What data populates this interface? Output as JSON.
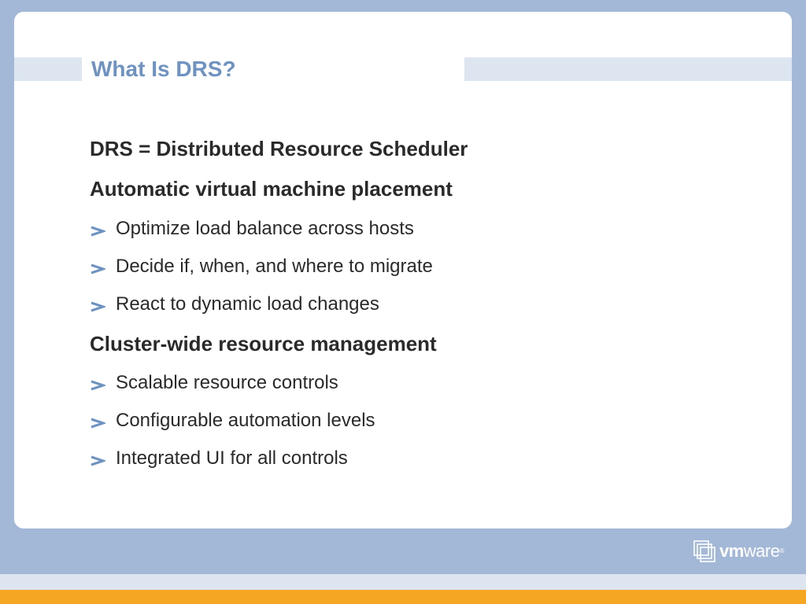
{
  "slide": {
    "title": "What Is DRS?",
    "items": [
      {
        "level": 1,
        "text": "DRS = Distributed Resource Scheduler"
      },
      {
        "level": 1,
        "text": "Automatic virtual machine placement"
      },
      {
        "level": 2,
        "text": "Optimize load balance across hosts"
      },
      {
        "level": 2,
        "text": "Decide if, when, and where to migrate"
      },
      {
        "level": 2,
        "text": "React to dynamic load changes"
      },
      {
        "level": 1,
        "text": "Cluster-wide resource management"
      },
      {
        "level": 2,
        "text": "Scalable resource controls"
      },
      {
        "level": 2,
        "text": "Configurable automation levels"
      },
      {
        "level": 2,
        "text": "Integrated UI for all controls"
      }
    ],
    "bullet_icon": "chevron-right-icon"
  },
  "footer": {
    "logo": {
      "vm": "vm",
      "ware": "ware",
      "mark": "®"
    }
  },
  "colors": {
    "background": "#a3b8d6",
    "title": "#6e93c1",
    "bullet": "#6e93c1",
    "text": "#2a2a2a",
    "accent_orange": "#f5a623",
    "band": "#dde5f0"
  }
}
